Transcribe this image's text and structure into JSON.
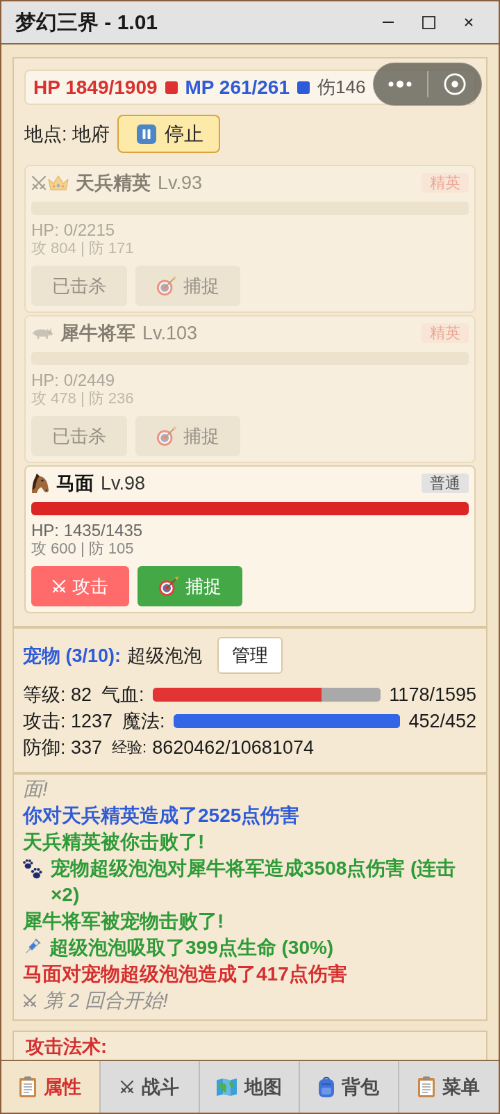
{
  "window": {
    "title": "梦幻三界 - 1.01"
  },
  "player": {
    "hp": "HP 1849/1909",
    "mp": "MP 261/261",
    "combat": "伤146"
  },
  "location": {
    "label": "地点: 地府",
    "button": "停止"
  },
  "enemies": [
    {
      "kind": "soldier",
      "targeted": true,
      "name": "天兵精英",
      "lv": "Lv.93",
      "badge": {
        "label": "精英",
        "kind": "elite"
      },
      "defeated": true,
      "hp": {
        "level": 0,
        "text": "HP: 0/2215"
      },
      "stats": "攻 804 | 防 171",
      "actions": [
        {
          "kind": "attack",
          "label": "已击杀",
          "disabled": true
        },
        {
          "kind": "capture",
          "label": "捕捉",
          "disabled": true
        }
      ]
    },
    {
      "kind": "rhino",
      "targeted": false,
      "name": "犀牛将军",
      "lv": "Lv.103",
      "badge": {
        "label": "精英",
        "kind": "elite"
      },
      "defeated": true,
      "hp": {
        "level": 0,
        "text": "HP: 0/2449"
      },
      "stats": "攻 478 | 防 236",
      "actions": [
        {
          "kind": "attack",
          "label": "已击杀",
          "disabled": true
        },
        {
          "kind": "capture",
          "label": "捕捉",
          "disabled": true
        }
      ]
    },
    {
      "kind": "horse",
      "targeted": false,
      "name": "马面",
      "lv": "Lv.98",
      "badge": {
        "label": "普通",
        "kind": "normal"
      },
      "defeated": false,
      "hp": {
        "level": 1,
        "text": "HP: 1435/1435"
      },
      "stats": "攻 600 | 防 105",
      "actions": [
        {
          "kind": "attack",
          "label": "攻击",
          "disabled": false
        },
        {
          "kind": "capture",
          "label": "捕捉",
          "disabled": false
        }
      ]
    }
  ],
  "pet": {
    "title": "宠物 (3/10):",
    "name": "超级泡泡",
    "button": "管理",
    "rows": [
      {
        "kind": "bar",
        "stat": "等级: 82",
        "label": "气血:",
        "level": 0.739,
        "reading": "1178/1595",
        "color": "#e33434"
      },
      {
        "kind": "bar",
        "stat": "攻击: 1237",
        "label": "魔法:",
        "level": 1,
        "reading": "452/452",
        "color": "#3366e6"
      },
      {
        "kind": "text",
        "stat": "防御: 337",
        "label": "经验:",
        "reading": "8620462/10681074"
      }
    ]
  },
  "battle_log": [
    {
      "kind": "system",
      "text": "面!"
    },
    {
      "kind": "player",
      "text": "你对天兵精英造成了2525点伤害"
    },
    {
      "kind": "defeat",
      "text": "天兵精英被你击败了!"
    },
    {
      "kind": "pet",
      "text": "宠物超级泡泡对犀牛将军造成3508点伤害 (连击×2)"
    },
    {
      "kind": "defeat",
      "text": "犀牛将军被宠物击败了!"
    },
    {
      "kind": "drain",
      "text": "超级泡泡吸取了399点生命 (30%)"
    },
    {
      "kind": "enemy",
      "text": "马面对宠物超级泡泡造成了417点伤害"
    },
    {
      "kind": "round",
      "text": "第 2 回合开始!"
    }
  ],
  "skills": {
    "title": "攻击法术:"
  },
  "nav": [
    {
      "kind": "attributes",
      "label": "属性",
      "selected": true
    },
    {
      "kind": "battle",
      "label": "战斗",
      "selected": false
    },
    {
      "kind": "map",
      "label": "地图",
      "selected": false
    },
    {
      "kind": "bag",
      "label": "背包",
      "selected": false
    },
    {
      "kind": "menu",
      "label": "菜单",
      "selected": false
    }
  ]
}
